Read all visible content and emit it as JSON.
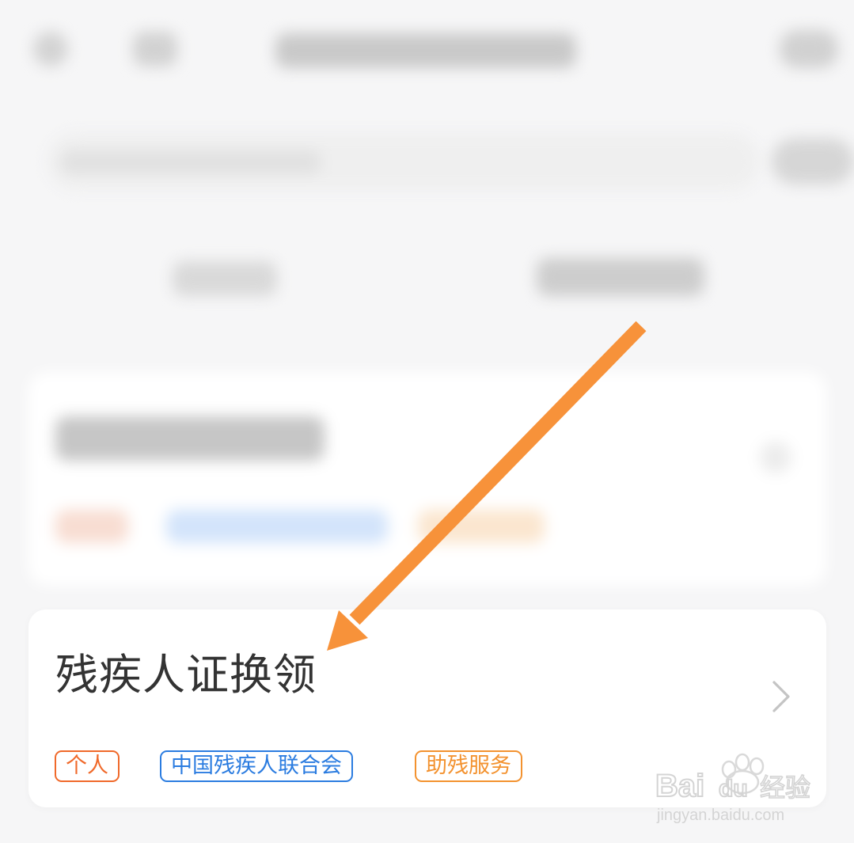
{
  "service_card": {
    "title": "残疾人证换领",
    "tags": {
      "personal": "个人",
      "organization": "中国残疾人联合会",
      "category": "助残服务"
    }
  },
  "annotation": {
    "arrow_color": "#f7923a"
  },
  "watermark": {
    "brand": "Baidu经验",
    "url": "jingyan.baidu.com"
  },
  "colors": {
    "tag_orange": "#f0692a",
    "tag_blue": "#2b7ce0",
    "tag_yellow": "#f3922f",
    "title_text": "#333333"
  }
}
